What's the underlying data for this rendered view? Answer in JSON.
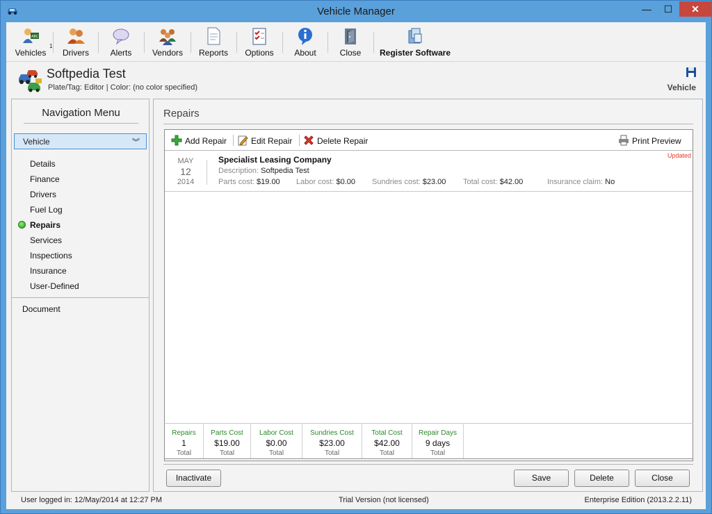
{
  "window": {
    "title": "Vehicle Manager",
    "minimize": "—",
    "maximize": "☐",
    "close": "✕"
  },
  "toolbar": {
    "items": [
      {
        "label": "Vehicles",
        "icon": "vehicles-icon",
        "badge": "1"
      },
      {
        "label": "Drivers",
        "icon": "drivers-icon"
      },
      {
        "label": "Alerts",
        "icon": "alerts-icon"
      },
      {
        "label": "Vendors",
        "icon": "vendors-icon"
      },
      {
        "label": "Reports",
        "icon": "reports-icon"
      },
      {
        "label": "Options",
        "icon": "options-icon"
      },
      {
        "label": "About",
        "icon": "about-icon"
      },
      {
        "label": "Close",
        "icon": "close-door-icon"
      },
      {
        "label": "Register Software",
        "icon": "register-software-icon"
      }
    ]
  },
  "header": {
    "vehicle_name": "Softpedia Test",
    "subtitle": "Plate/Tag: Editor   |   Color: (no color specified)",
    "mode": "Vehicle"
  },
  "nav": {
    "title": "Navigation Menu",
    "selected": "Vehicle",
    "items": [
      "Details",
      "Finance",
      "Drivers",
      "Fuel Log",
      "Repairs",
      "Services",
      "Inspections",
      "Insurance",
      "User-Defined"
    ],
    "active_item": "Repairs",
    "document": "Document"
  },
  "content": {
    "title": "Repairs",
    "toolbar": {
      "add": "Add Repair",
      "edit": "Edit Repair",
      "delete": "Delete Repair",
      "print": "Print Preview"
    },
    "record": {
      "month": "MAY",
      "day": "12",
      "year": "2014",
      "vendor": "Specialist Leasing Company",
      "description_label": "Description:",
      "description": "Softpedia Test",
      "parts_label": "Parts cost:",
      "parts": "$19.00",
      "labor_label": "Labor cost:",
      "labor": "$0.00",
      "sundries_label": "Sundries cost:",
      "sundries": "$23.00",
      "total_label": "Total cost:",
      "total": "$42.00",
      "insurance_label": "Insurance claim:",
      "insurance": "No",
      "status": "Updated"
    },
    "totals": [
      {
        "header": "Repairs",
        "value": "1",
        "footer": "Total"
      },
      {
        "header": "Parts Cost",
        "value": "$19.00",
        "footer": "Total"
      },
      {
        "header": "Labor Cost",
        "value": "$0.00",
        "footer": "Total"
      },
      {
        "header": "Sundries Cost",
        "value": "$23.00",
        "footer": "Total"
      },
      {
        "header": "Total Cost",
        "value": "$42.00",
        "footer": "Total"
      },
      {
        "header": "Repair Days",
        "value": "9 days",
        "footer": "Total"
      }
    ],
    "buttons": {
      "inactivate": "Inactivate",
      "save": "Save",
      "delete": "Delete",
      "close": "Close"
    }
  },
  "status": {
    "user": "User logged in:  12/May/2014 at 12:27 PM",
    "license": "Trial Version (not licensed)",
    "edition": "Enterprise Edition (2013.2.2.11)"
  }
}
